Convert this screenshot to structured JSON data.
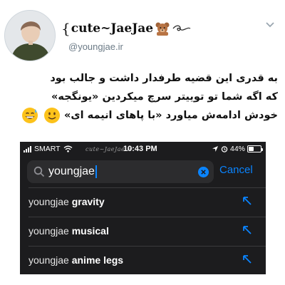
{
  "tweet": {
    "display_name": "cute~JaeJae",
    "handle": "@youngjae.ir",
    "text_lines": [
      "به قدری این قضیه طرفدار داشت و جالب بود",
      "که اگه شما تو توییتر سرچ میکردین «یونگجه»",
      "خودش ادامه‌ش میاورد «با پاهای انیمه ای»"
    ],
    "emojis": [
      "slightly-smiling-face",
      "grinning-sweat-face"
    ]
  },
  "phone": {
    "statusbar": {
      "carrier": "SMART",
      "time": "10:43 PM",
      "battery": "44%",
      "battery_level": 0.44,
      "watermark": "cute~JaeJae.ir"
    },
    "search": {
      "value": "youngjae",
      "cancel_label": "Cancel"
    },
    "suggestions": [
      {
        "prefix": "youngjae",
        "rest": " gravity"
      },
      {
        "prefix": "youngjae",
        "rest": " musical"
      },
      {
        "prefix": "youngjae",
        "rest": " anime legs"
      }
    ]
  },
  "colors": {
    "ios_blue": "#0a84ff",
    "dark_bg": "#1c1c1e",
    "search_bg": "#2c2c2e"
  }
}
